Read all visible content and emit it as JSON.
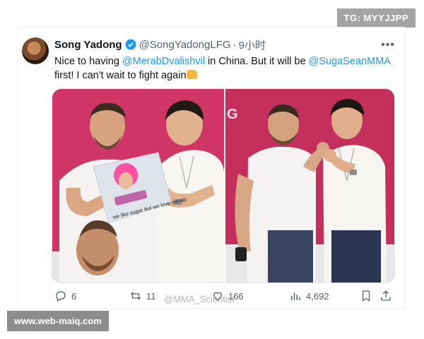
{
  "watermarks": {
    "tg_badge": "TG: MYYJJPP",
    "site_badge": "www.web-maiq.com",
    "weibo": "@MMA_Scientist"
  },
  "tweet": {
    "author": {
      "name": "Song Yadong",
      "handle": "@SongYadongLFG",
      "separator": "·",
      "time": "9小时"
    },
    "text": {
      "part1": "Nice to having ",
      "mention1": "@MerabDvalishvil",
      "part2": " in China. But it will be ",
      "mention2": "@SugaSeanMMA",
      "part3": " first! I can't wait to fight again"
    },
    "media": {
      "pillow_text": "we like sugar but we love merab",
      "right_photo_edge_letter": "G"
    },
    "actions": {
      "replies": "6",
      "retweets": "11",
      "likes": "166",
      "views": "4,692"
    }
  },
  "colors": {
    "accent": "#1d9bf0",
    "muted": "#536471",
    "stage": "#c9335f"
  }
}
